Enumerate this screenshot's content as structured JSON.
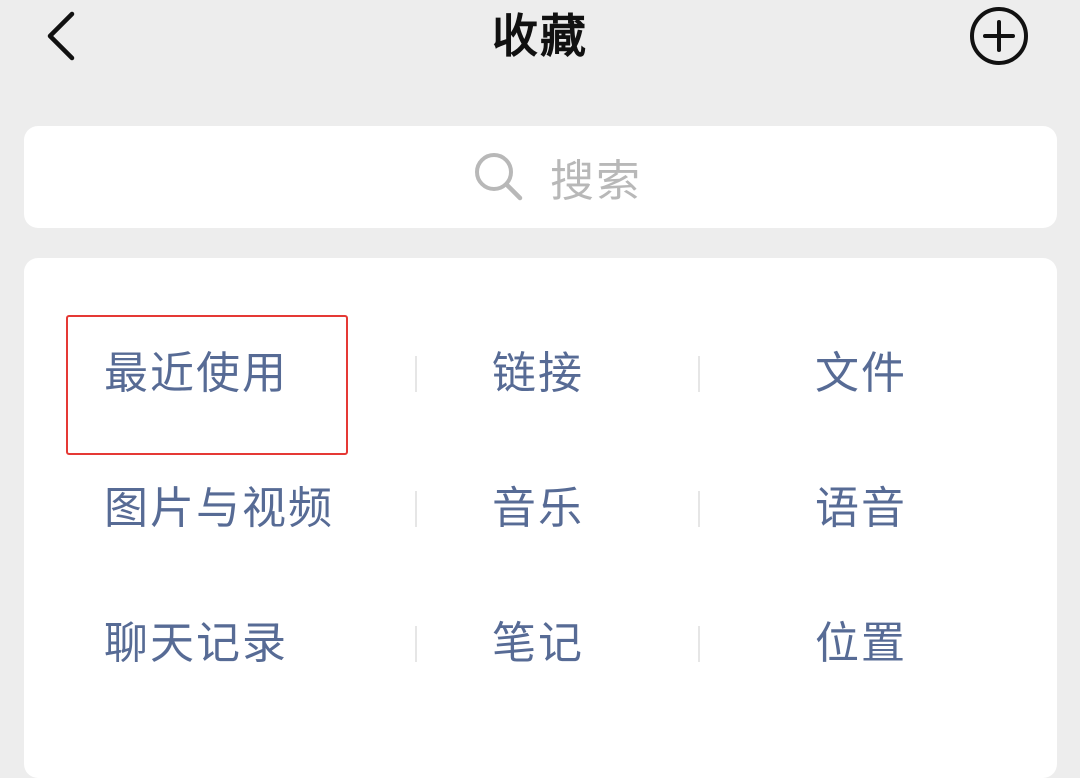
{
  "header": {
    "title": "收藏",
    "back_icon": "chevron-left-icon",
    "add_icon": "plus-circle-icon"
  },
  "search": {
    "placeholder": "搜索",
    "icon": "search-icon"
  },
  "categories": [
    [
      "最近使用",
      "链接",
      "文件"
    ],
    [
      "图片与视频",
      "音乐",
      "语音"
    ],
    [
      "聊天记录",
      "笔记",
      "位置"
    ]
  ],
  "colors": {
    "background": "#ededed",
    "card": "#ffffff",
    "category_text": "#576b95",
    "highlight_border": "#e53935"
  }
}
